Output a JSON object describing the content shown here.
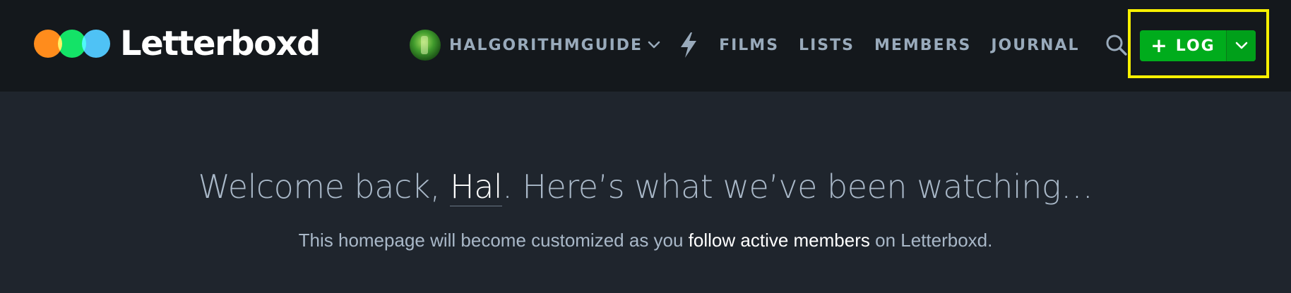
{
  "brand": {
    "name": "Letterboxd",
    "colors": {
      "orange": "#ff8000",
      "green": "#00e054",
      "blue": "#40bcf4"
    }
  },
  "nav": {
    "username": "HALGORITHMGUIDE",
    "links": [
      "FILMS",
      "LISTS",
      "MEMBERS",
      "JOURNAL"
    ],
    "icons": {
      "avatar": "avatar",
      "user_menu": "chevron-down-icon",
      "activity": "lightning-bolt-icon",
      "search": "search-icon"
    }
  },
  "log_button": {
    "label": "LOG",
    "plus": "+",
    "color": "#00ac1c",
    "caret_icon": "chevron-down-icon"
  },
  "welcome": {
    "prefix": "Welcome back, ",
    "name": "Hal",
    "suffix": ". Here’s what we’ve been watching…"
  },
  "subline": {
    "prefix": "This homepage will become customized as you ",
    "link": "follow active members",
    "suffix": " on Letterboxd."
  }
}
